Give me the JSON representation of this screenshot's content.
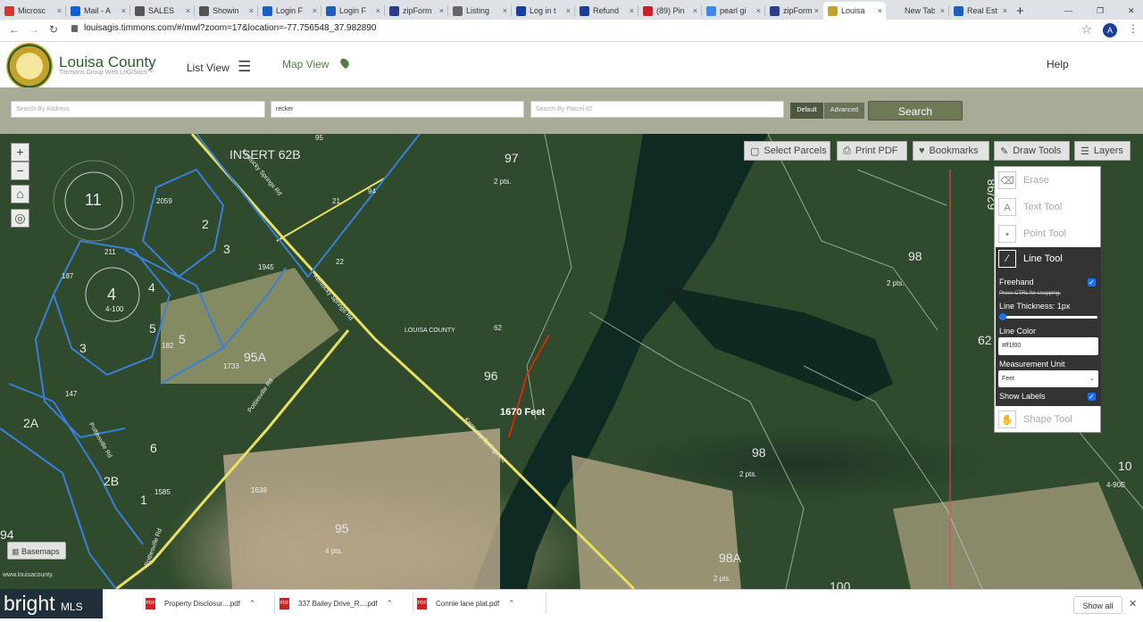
{
  "browser": {
    "tabs": [
      {
        "label": "Microsc",
        "favicon_color": "#d33"
      },
      {
        "label": "Mail - A",
        "favicon_color": "#0a64d8"
      },
      {
        "label": "SALES",
        "favicon_color": "#555"
      },
      {
        "label": "Showin",
        "favicon_color": "#555"
      },
      {
        "label": "Login F",
        "favicon_color": "#1a5ec2"
      },
      {
        "label": "Login F",
        "favicon_color": "#1a5ec2"
      },
      {
        "label": "zipForm",
        "favicon_color": "#2b3e8c"
      },
      {
        "label": "Listing",
        "favicon_color": "#666"
      },
      {
        "label": "Log in t",
        "favicon_color": "#1a3e9c"
      },
      {
        "label": "Refund",
        "favicon_color": "#1a3e9c"
      },
      {
        "label": "(89) Pin",
        "favicon_color": "#c8232c"
      },
      {
        "label": "pearl gi",
        "favicon_color": "#4285f4"
      },
      {
        "label": "zipForm",
        "favicon_color": "#2b3e8c"
      },
      {
        "label": "Louisa",
        "favicon_color": "#c5a22a"
      },
      {
        "label": "New Tab",
        "favicon_color": "#dee1e6"
      },
      {
        "label": "Real Est",
        "favicon_color": "#1a5ec2"
      }
    ],
    "active_tab_index": 13,
    "new_tab_symbol": "+",
    "url": "louisagis.timmons.com/#/mwl?zoom=17&location=-77.756548_37.982890",
    "profile_initial": "A"
  },
  "app": {
    "name": "Louisa County",
    "subtitle": "Timmons Group Web LoGIStics™",
    "nav_list": "List View",
    "nav_map": "Map View",
    "help": "Help"
  },
  "search": {
    "address_placeholder": "Search By Address",
    "owner_value": "recker",
    "parcel_placeholder": "Search By Parcel ID",
    "default_label": "Default",
    "advanced_label": "Advanced",
    "search_label": "Search"
  },
  "map": {
    "toolbar": {
      "select_parcels": "Select Parcels",
      "print_pdf": "Print PDF",
      "bookmarks": "Bookmarks",
      "draw_tools": "Draw Tools",
      "layers": "Layers"
    },
    "basemaps": "Basemaps",
    "credit": "www.louisacounty.",
    "labels": {
      "insert": "INSERT 62B",
      "p97": "97",
      "p97sub": "2 pts.",
      "p98": "98",
      "p98sub": "2 pts.",
      "p62_98": "62/98",
      "p62": "62",
      "p11": "11",
      "p2": "2",
      "p3": "3",
      "p4": "4",
      "p5": "5",
      "p6": "6",
      "p1": "1",
      "p2a": "2A",
      "p2b": "2B",
      "p95a": "95A",
      "p96": "96",
      "p98b": "98",
      "p98bsub": "2 pts.",
      "p95": "95",
      "p95sub": "4 pts.",
      "p98a": "98A",
      "p98asub": "2 pts.",
      "p10": "10",
      "p10sub": "4-90E",
      "p100": "100",
      "p94": "94",
      "measure": "1670 Feet",
      "county": "LOUISA COUNTY",
      "n2059": "2059",
      "n95": "95",
      "n21": "21",
      "n94": "94",
      "n22": "22",
      "n1945": "1945",
      "n211": "211",
      "n187": "187",
      "n182": "182",
      "n1733": "1733",
      "n147": "147",
      "n1585": "1585",
      "n1638": "1638",
      "n62": "62",
      "n4sub": "4-100",
      "road1": "Kentucky Springs Rd",
      "road2": "Pottiesville Rd",
      "road3": "Kentucky Springs Rd",
      "road4": "Pottiesville Rd"
    }
  },
  "draw_panel": {
    "erase": "Erase",
    "text_tool": "Text Tool",
    "point_tool": "Point Tool",
    "line_tool": "Line Tool",
    "freehand": "Freehand",
    "ctrl_note": "Press CTRL for snapping.",
    "line_thickness": "Line Thickness: 1px",
    "line_color_label": "Line Color",
    "line_color_value": "#ff1f00",
    "measurement_unit_label": "Measurement Unit",
    "measurement_unit_value": "Feet",
    "show_labels": "Show Labels",
    "shape_tool": "Shape Tool",
    "freehand_checked": true,
    "show_labels_checked": true
  },
  "downloads": {
    "items": [
      "Property Disclosur....pdf",
      "337 Bailey Drive_R....pdf",
      "Connie lane plat.pdf"
    ],
    "show_all": "Show all",
    "watermark": "bright",
    "watermark_suffix": "MLS"
  },
  "colors": {
    "parcel_line": "#3a7fd8",
    "road_yellow": "#e8e060",
    "measure_line": "#ff1f00",
    "header_green": "#2c5f2d",
    "search_band": "#a8ac96"
  }
}
